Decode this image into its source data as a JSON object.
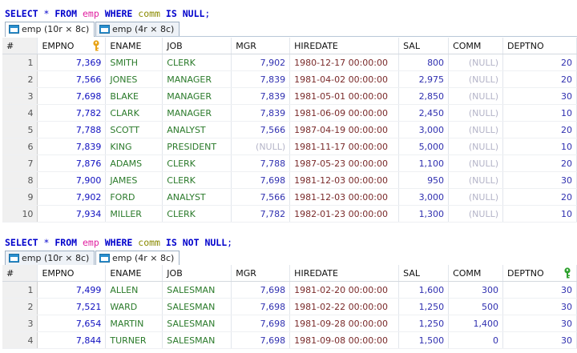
{
  "queries": [
    {
      "sql": [
        {
          "t": "SELECT",
          "c": "kw"
        },
        {
          "t": " ",
          "c": ""
        },
        {
          "t": "*",
          "c": "op"
        },
        {
          "t": " ",
          "c": ""
        },
        {
          "t": "FROM",
          "c": "kw"
        },
        {
          "t": " ",
          "c": ""
        },
        {
          "t": "emp",
          "c": "tbl"
        },
        {
          "t": " ",
          "c": ""
        },
        {
          "t": "WHERE",
          "c": "kw"
        },
        {
          "t": " ",
          "c": ""
        },
        {
          "t": "comm",
          "c": "col"
        },
        {
          "t": " ",
          "c": ""
        },
        {
          "t": "IS",
          "c": "kw"
        },
        {
          "t": " ",
          "c": ""
        },
        {
          "t": "NULL",
          "c": "kw"
        },
        {
          "t": ";",
          "c": "op"
        }
      ],
      "tabs": [
        {
          "label": "emp (10r × 8c)",
          "active": true
        },
        {
          "label": "emp (4r × 8c)",
          "active": false
        }
      ],
      "columns": [
        "#",
        "EMPNO",
        "ENAME",
        "JOB",
        "MGR",
        "HIREDATE",
        "SAL",
        "COMM",
        "DEPTNO"
      ],
      "key_column": "EMPNO",
      "rows": [
        [
          "1",
          "7,369",
          "SMITH",
          "CLERK",
          "7,902",
          "1980-12-17 00:00:00",
          "800",
          "(NULL)",
          "20"
        ],
        [
          "2",
          "7,566",
          "JONES",
          "MANAGER",
          "7,839",
          "1981-04-02 00:00:00",
          "2,975",
          "(NULL)",
          "20"
        ],
        [
          "3",
          "7,698",
          "BLAKE",
          "MANAGER",
          "7,839",
          "1981-05-01 00:00:00",
          "2,850",
          "(NULL)",
          "30"
        ],
        [
          "4",
          "7,782",
          "CLARK",
          "MANAGER",
          "7,839",
          "1981-06-09 00:00:00",
          "2,450",
          "(NULL)",
          "10"
        ],
        [
          "5",
          "7,788",
          "SCOTT",
          "ANALYST",
          "7,566",
          "1987-04-19 00:00:00",
          "3,000",
          "(NULL)",
          "20"
        ],
        [
          "6",
          "7,839",
          "KING",
          "PRESIDENT",
          "(NULL)",
          "1981-11-17 00:00:00",
          "5,000",
          "(NULL)",
          "10"
        ],
        [
          "7",
          "7,876",
          "ADAMS",
          "CLERK",
          "7,788",
          "1987-05-23 00:00:00",
          "1,100",
          "(NULL)",
          "20"
        ],
        [
          "8",
          "7,900",
          "JAMES",
          "CLERK",
          "7,698",
          "1981-12-03 00:00:00",
          "950",
          "(NULL)",
          "30"
        ],
        [
          "9",
          "7,902",
          "FORD",
          "ANALYST",
          "7,566",
          "1981-12-03 00:00:00",
          "3,000",
          "(NULL)",
          "20"
        ],
        [
          "10",
          "7,934",
          "MILLER",
          "CLERK",
          "7,782",
          "1982-01-23 00:00:00",
          "1,300",
          "(NULL)",
          "10"
        ]
      ]
    },
    {
      "sql": [
        {
          "t": "SELECT",
          "c": "kw"
        },
        {
          "t": " ",
          "c": ""
        },
        {
          "t": "*",
          "c": "op"
        },
        {
          "t": " ",
          "c": ""
        },
        {
          "t": "FROM",
          "c": "kw"
        },
        {
          "t": " ",
          "c": ""
        },
        {
          "t": "emp",
          "c": "tbl"
        },
        {
          "t": " ",
          "c": ""
        },
        {
          "t": "WHERE",
          "c": "kw"
        },
        {
          "t": " ",
          "c": ""
        },
        {
          "t": "comm",
          "c": "col"
        },
        {
          "t": " ",
          "c": ""
        },
        {
          "t": "IS",
          "c": "kw"
        },
        {
          "t": " ",
          "c": ""
        },
        {
          "t": "NOT",
          "c": "kw"
        },
        {
          "t": " ",
          "c": ""
        },
        {
          "t": "NULL",
          "c": "kw"
        },
        {
          "t": ";",
          "c": "op"
        }
      ],
      "tabs": [
        {
          "label": "emp (10r × 8c)",
          "active": false
        },
        {
          "label": "emp (4r × 8c)",
          "active": true
        }
      ],
      "columns": [
        "#",
        "EMPNO",
        "ENAME",
        "JOB",
        "MGR",
        "HIREDATE",
        "SAL",
        "COMM",
        "DEPTNO"
      ],
      "key_column": "DEPTNO",
      "rows": [
        [
          "1",
          "7,499",
          "ALLEN",
          "SALESMAN",
          "7,698",
          "1981-02-20 00:00:00",
          "1,600",
          "300",
          "30"
        ],
        [
          "2",
          "7,521",
          "WARD",
          "SALESMAN",
          "7,698",
          "1981-02-22 00:00:00",
          "1,250",
          "500",
          "30"
        ],
        [
          "3",
          "7,654",
          "MARTIN",
          "SALESMAN",
          "7,698",
          "1981-09-28 00:00:00",
          "1,250",
          "1,400",
          "30"
        ],
        [
          "4",
          "7,844",
          "TURNER",
          "SALESMAN",
          "7,698",
          "1981-09-08 00:00:00",
          "1,500",
          "0",
          "30"
        ]
      ]
    }
  ],
  "colors": {
    "key_icon_gold": "#e8a317",
    "key_icon_green": "#2ea12e",
    "tab_icon": "#2a8fcf"
  }
}
